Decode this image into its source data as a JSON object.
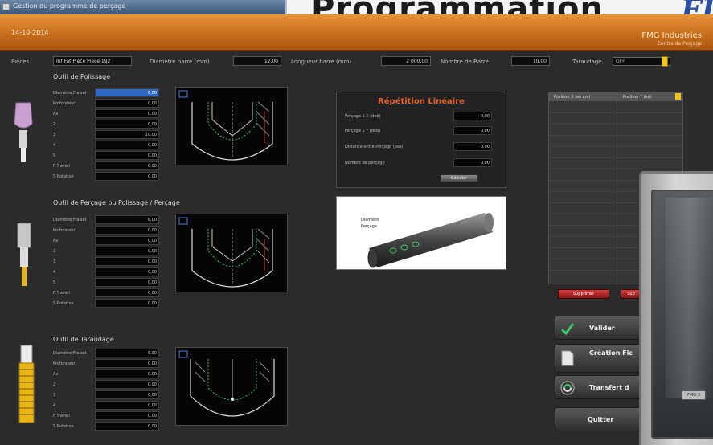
{
  "window": {
    "title": "Gestion du programme de perçage"
  },
  "banner": {
    "title": "Programmation",
    "brand": "FI"
  },
  "appbar": {
    "date": "14-10-2014",
    "brand_name": "FMG Industries",
    "brand_sub": "Centre de Perçage"
  },
  "params": {
    "pieces_label": "Pièces",
    "pieces_value": "Inf Fat Piece Piece 192",
    "diam_label": "Diamètre barre (mm)",
    "diam_value": "12,00",
    "long_label": "Longueur barre (mm)",
    "long_value": "2 000,00",
    "nb_label": "Nombre de Barre",
    "nb_value": "10,00",
    "tar_label": "Taraudage",
    "tar_value": "OFF"
  },
  "section1": {
    "title": "Outil de Polissage",
    "rows": [
      {
        "label": "Diamètre Fraiset",
        "value": "6,00"
      },
      {
        "label": "Profondeur",
        "value": "0,00"
      },
      {
        "label": "Ax",
        "value": "0,00"
      },
      {
        "label": "2",
        "value": "0,00"
      },
      {
        "label": "3",
        "value": "10,00"
      },
      {
        "label": "4",
        "value": "0,00"
      },
      {
        "label": "5",
        "value": "0,00"
      },
      {
        "label": "F Travail",
        "value": "0,00"
      },
      {
        "label": "S Rotation",
        "value": "0,00"
      }
    ]
  },
  "section2": {
    "title": "Outil de Perçage ou Polissage / Perçage",
    "rows": [
      {
        "label": "Diamètre Fraiset",
        "value": "6,00"
      },
      {
        "label": "Profondeur",
        "value": "0,00"
      },
      {
        "label": "Ax",
        "value": "0,00"
      },
      {
        "label": "2",
        "value": "0,00"
      },
      {
        "label": "3",
        "value": "0,00"
      },
      {
        "label": "4",
        "value": "0,00"
      },
      {
        "label": "5",
        "value": "0,00"
      },
      {
        "label": "F Travail",
        "value": "0,00"
      },
      {
        "label": "S Rotation",
        "value": "0,00"
      }
    ]
  },
  "section3": {
    "title": "Outil de Taraudage",
    "rows": [
      {
        "label": "Diamètre Fraiset",
        "value": "6,00"
      },
      {
        "label": "Profondeur",
        "value": "0,00"
      },
      {
        "label": "Ax",
        "value": "0,00"
      },
      {
        "label": "2",
        "value": "0,00"
      },
      {
        "label": "3",
        "value": "0,00"
      },
      {
        "label": "4",
        "value": "0,00"
      },
      {
        "label": "F Travail",
        "value": "0,00"
      },
      {
        "label": "S Rotation",
        "value": "0,00"
      }
    ]
  },
  "repetition": {
    "title": "Répétition Linéaire",
    "rows": [
      {
        "label": "Perçage 1 X (deb)",
        "value": "0,00"
      },
      {
        "label": "Perçage 1 Y (deb)",
        "value": "0,00"
      },
      {
        "label": "Distance entre Perçage (pas)",
        "value": "0,00"
      },
      {
        "label": "Nombre de perçage",
        "value": "0,00"
      }
    ],
    "button": "Calculer"
  },
  "preview": {
    "label1": "Diamètre",
    "label2": "Perçage"
  },
  "positions": {
    "col1": "Position X (en cm)",
    "col2": "Position Y (en)"
  },
  "buttons": {
    "suppr1": "Supprimer",
    "suppr2": "Sup",
    "valider": "Valider",
    "creation": "Création Fic",
    "transfert": "Transfert d",
    "quitter": "Quitter"
  },
  "device": {
    "chip": "FMG 3"
  },
  "colors": {
    "accent": "#d8782a",
    "panel_bg": "#2b2b2b",
    "title_orange": "#e0602a",
    "selected": "#2d69c2"
  }
}
